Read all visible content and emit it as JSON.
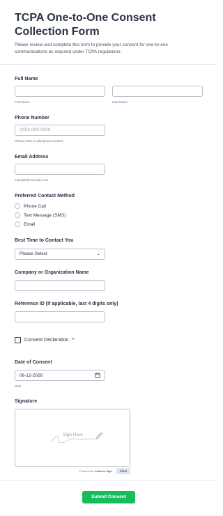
{
  "form": {
    "title": "TCPA One-to-One Consent Collection Form",
    "description": "Please review and complete this form to provide your consent for one-to-one communications as required under TCPA regulations."
  },
  "full_name": {
    "label": "Full Name",
    "first_sublabel": "First Name",
    "last_sublabel": "Last Name",
    "first_value": "",
    "last_value": ""
  },
  "phone": {
    "label": "Phone Number",
    "placeholder": "(000) 000-0000",
    "sublabel": "Please enter a valid phone number."
  },
  "email": {
    "label": "Email Address",
    "sublabel": "example@example.com",
    "value": ""
  },
  "contact_method": {
    "label": "Preferred Contact Method",
    "options": [
      "Phone Call",
      "Text Message (SMS)",
      "Email"
    ]
  },
  "best_time": {
    "label": "Best Time to Contact You",
    "selected": "Please Select"
  },
  "company": {
    "label": "Company or Organization Name",
    "value": ""
  },
  "reference": {
    "label": "Reference ID (if applicable, last 4 digits only)",
    "value": ""
  },
  "consent": {
    "label": "Consent Declaration",
    "required_mark": "*"
  },
  "date": {
    "label": "Date of Consent",
    "value": "06-12-2026",
    "sublabel": "Date"
  },
  "signature": {
    "label": "Signature",
    "placeholder": "Sign Here",
    "powered_prefix": "Powered by ",
    "powered_brand": "Jotform Sign",
    "clear_label": "Clear"
  },
  "submit": {
    "label": "Submit Consent"
  },
  "colors": {
    "accent": "#18bd5b",
    "required": "#e1342a",
    "text": "#2c3345"
  },
  "icons": {
    "calendar": "calendar-icon",
    "dropdown": "chevron-down-icon",
    "pen": "pen-icon"
  }
}
